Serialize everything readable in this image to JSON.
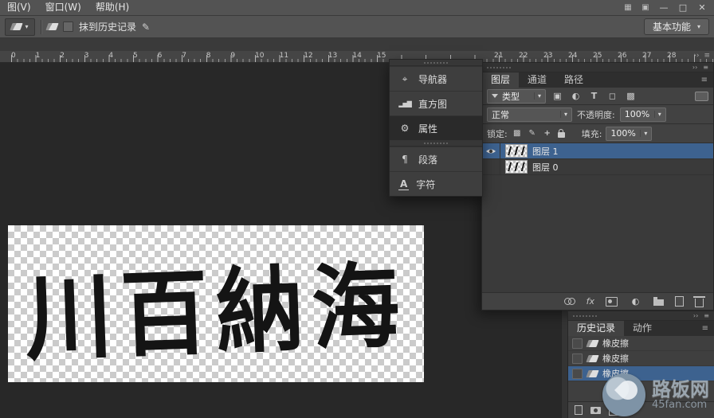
{
  "menu_bar": {
    "items": [
      "图(V)",
      "窗口(W)",
      "帮助(H)"
    ],
    "window_controls": [
      "—",
      "□",
      "✕"
    ]
  },
  "options_bar": {
    "erase_to_history_label": "抹到历史记录",
    "workspace_button_label": "基本功能"
  },
  "ruler": {
    "left_numbers": [
      "0",
      "1",
      "2",
      "3",
      "4",
      "5",
      "6",
      "7",
      "8",
      "9",
      "10",
      "11",
      "12",
      "13",
      "14",
      "15"
    ],
    "right_numbers": [
      "21",
      "22",
      "23",
      "24",
      "25",
      "26",
      "27",
      "28"
    ]
  },
  "panel_dock": {
    "group1": [
      {
        "icon": "navigator-icon",
        "label": "导航器"
      },
      {
        "icon": "histogram-icon",
        "label": "直方图"
      },
      {
        "icon": "properties-icon",
        "label": "属性",
        "active": true
      }
    ],
    "group2": [
      {
        "icon": "paragraph-icon",
        "label": "段落"
      },
      {
        "icon": "character-icon",
        "label": "字符"
      }
    ]
  },
  "layers_panel": {
    "tabs": [
      "图层",
      "通道",
      "路径"
    ],
    "kind_filter_label": "类型",
    "blend_mode_value": "正常",
    "opacity_label": "不透明度:",
    "opacity_value": "100%",
    "lock_label": "锁定:",
    "fill_label": "填充:",
    "fill_value": "100%",
    "fx_label": "fx",
    "layers": [
      {
        "name": "图层 1",
        "visible": true,
        "selected": true
      },
      {
        "name": "图层 0",
        "visible": false,
        "selected": false
      }
    ]
  },
  "history_panel": {
    "tabs": [
      "历史记录",
      "动作"
    ],
    "entries": [
      {
        "label": "橡皮擦",
        "selected": false
      },
      {
        "label": "橡皮擦",
        "selected": false
      },
      {
        "label": "橡皮擦",
        "selected": true
      }
    ]
  },
  "canvas": {
    "calligraphy_text": "川百納海"
  },
  "watermark": {
    "site_name": "路饭网",
    "site_url": "45fan.com"
  },
  "colors": {
    "selection_blue": "#3d628f",
    "panel_bg": "#3f3f3f",
    "bar_bg": "#535353",
    "workspace_bg": "#282828"
  }
}
